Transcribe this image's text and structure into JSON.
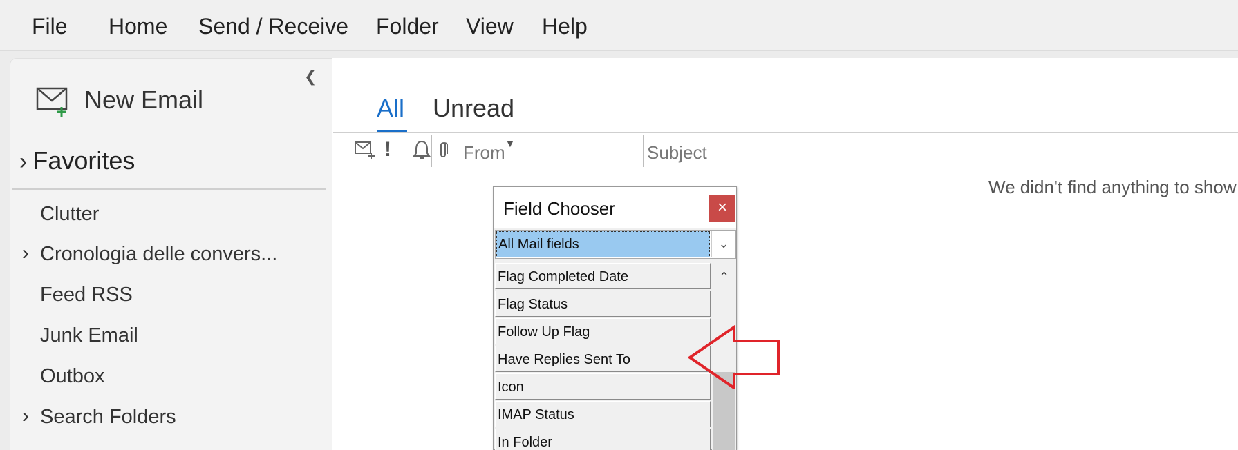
{
  "menu": [
    "File",
    "Home",
    "Send / Receive",
    "Folder",
    "View",
    "Help"
  ],
  "sidebar": {
    "new_email_label": "New Email",
    "favorites_label": "Favorites",
    "items": [
      {
        "label": "Clutter",
        "expandable": false
      },
      {
        "label": "Cronologia delle convers...",
        "expandable": true
      },
      {
        "label": "Feed RSS",
        "expandable": false
      },
      {
        "label": "Junk Email",
        "expandable": false
      },
      {
        "label": "Outbox",
        "expandable": false
      },
      {
        "label": "Search Folders",
        "expandable": true
      }
    ]
  },
  "tabs": {
    "all": "All",
    "unread": "Unread"
  },
  "columns": {
    "from": "From",
    "subject": "Subject"
  },
  "empty_message": "We didn't find anything to show",
  "field_chooser": {
    "title": "Field Chooser",
    "close": "×",
    "selected_category": "All Mail fields",
    "fields": [
      "Flag Completed Date",
      "Flag Status",
      "Follow Up Flag",
      "Have Replies Sent To",
      "Icon",
      "IMAP Status",
      "In Folder"
    ]
  },
  "colors": {
    "accent": "#1a6fc9",
    "annotation": "#e0242a",
    "close_button": "#c94a48",
    "selection": "#99c9f0"
  }
}
